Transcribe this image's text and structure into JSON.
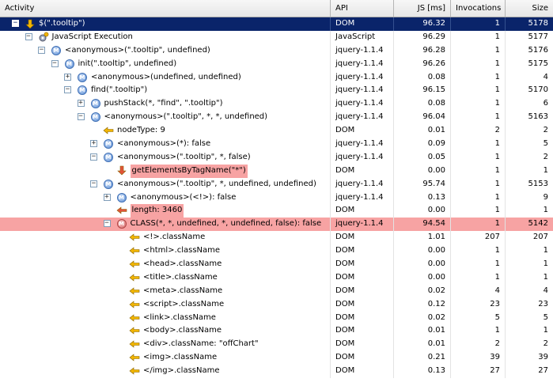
{
  "columns": {
    "activity": "Activity",
    "api": "API",
    "js": "JS [ms]",
    "invocations": "Invocations",
    "size": "Size"
  },
  "rows": [
    {
      "name": "$(\".tooltip\")",
      "api": "DOM",
      "js": "96.32",
      "inv": "1",
      "size": "5178",
      "level": 0,
      "toggle": "−",
      "icon": "arrow-down-icon",
      "selected": true
    },
    {
      "name": "JavaScript Execution",
      "api": "JavaScript",
      "js": "96.29",
      "inv": "1",
      "size": "5177",
      "level": 1,
      "toggle": "−",
      "icon": "gear-icon"
    },
    {
      "name": "<anonymous>(\".tooltip\", undefined)",
      "api": "jquery-1.1.4",
      "js": "96.28",
      "inv": "1",
      "size": "5176",
      "level": 2,
      "toggle": "−",
      "icon": "method-icon"
    },
    {
      "name": "init(\".tooltip\", undefined)",
      "api": "jquery-1.1.4",
      "js": "96.26",
      "inv": "1",
      "size": "5175",
      "level": 3,
      "toggle": "−",
      "icon": "method-icon"
    },
    {
      "name": "<anonymous>(undefined, undefined)",
      "api": "jquery-1.1.4",
      "js": "0.08",
      "inv": "1",
      "size": "4",
      "level": 4,
      "toggle": "+",
      "icon": "method-icon"
    },
    {
      "name": "find(\".tooltip\")",
      "api": "jquery-1.1.4",
      "js": "96.15",
      "inv": "1",
      "size": "5170",
      "level": 4,
      "toggle": "−",
      "icon": "method-icon"
    },
    {
      "name": "pushStack(*, \"find\", \".tooltip\")",
      "api": "jquery-1.1.4",
      "js": "0.08",
      "inv": "1",
      "size": "6",
      "level": 5,
      "toggle": "+",
      "icon": "method-icon"
    },
    {
      "name": "<anonymous>(\".tooltip\", *, *, undefined)",
      "api": "jquery-1.1.4",
      "js": "96.04",
      "inv": "1",
      "size": "5163",
      "level": 5,
      "toggle": "−",
      "icon": "method-icon"
    },
    {
      "name": "nodeType: 9",
      "api": "DOM",
      "js": "0.01",
      "inv": "2",
      "size": "2",
      "level": 6,
      "toggle": "",
      "icon": "arrow-left-icon"
    },
    {
      "name": "<anonymous>(*): false",
      "api": "jquery-1.1.4",
      "js": "0.09",
      "inv": "1",
      "size": "5",
      "level": 6,
      "toggle": "+",
      "icon": "method-icon"
    },
    {
      "name": "<anonymous>(\".tooltip\", *, false)",
      "api": "jquery-1.1.4",
      "js": "0.05",
      "inv": "1",
      "size": "2",
      "level": 6,
      "toggle": "−",
      "icon": "method-icon"
    },
    {
      "name": "getElementsByTagName(\"*\")",
      "api": "DOM",
      "js": "0.00",
      "inv": "1",
      "size": "1",
      "level": 7,
      "toggle": "",
      "icon": "arrow-down-red-icon",
      "hl": "label"
    },
    {
      "name": "<anonymous>(\".tooltip\", *, undefined, undefined)",
      "api": "jquery-1.1.4",
      "js": "95.74",
      "inv": "1",
      "size": "5153",
      "level": 6,
      "toggle": "−",
      "icon": "method-icon"
    },
    {
      "name": "<anonymous>(<!>): false",
      "api": "jquery-1.1.4",
      "js": "0.13",
      "inv": "1",
      "size": "9",
      "level": 7,
      "toggle": "+",
      "icon": "method-icon"
    },
    {
      "name": "length: 3460",
      "api": "DOM",
      "js": "0.00",
      "inv": "1",
      "size": "1",
      "level": 7,
      "toggle": "",
      "icon": "arrow-left-red-icon",
      "hl": "label"
    },
    {
      "name": "CLASS(*, *, undefined, *, undefined, false): false",
      "api": "jquery-1.1.4",
      "js": "94.54",
      "inv": "1",
      "size": "5142",
      "level": 7,
      "toggle": "−",
      "icon": "method-red-icon",
      "hl": "full"
    },
    {
      "name": "<!>.className",
      "api": "DOM",
      "js": "1.01",
      "inv": "207",
      "size": "207",
      "level": 8,
      "toggle": "",
      "icon": "arrow-left-icon"
    },
    {
      "name": "<html>.className",
      "api": "DOM",
      "js": "0.00",
      "inv": "1",
      "size": "1",
      "level": 8,
      "toggle": "",
      "icon": "arrow-left-icon"
    },
    {
      "name": "<head>.className",
      "api": "DOM",
      "js": "0.00",
      "inv": "1",
      "size": "1",
      "level": 8,
      "toggle": "",
      "icon": "arrow-left-icon"
    },
    {
      "name": "<title>.className",
      "api": "DOM",
      "js": "0.00",
      "inv": "1",
      "size": "1",
      "level": 8,
      "toggle": "",
      "icon": "arrow-left-icon"
    },
    {
      "name": "<meta>.className",
      "api": "DOM",
      "js": "0.02",
      "inv": "4",
      "size": "4",
      "level": 8,
      "toggle": "",
      "icon": "arrow-left-icon"
    },
    {
      "name": "<script>.className",
      "api": "DOM",
      "js": "0.12",
      "inv": "23",
      "size": "23",
      "level": 8,
      "toggle": "",
      "icon": "arrow-left-icon"
    },
    {
      "name": "<link>.className",
      "api": "DOM",
      "js": "0.02",
      "inv": "5",
      "size": "5",
      "level": 8,
      "toggle": "",
      "icon": "arrow-left-icon"
    },
    {
      "name": "<body>.className",
      "api": "DOM",
      "js": "0.01",
      "inv": "1",
      "size": "1",
      "level": 8,
      "toggle": "",
      "icon": "arrow-left-icon"
    },
    {
      "name": "<div>.className: \"offChart\"",
      "api": "DOM",
      "js": "0.01",
      "inv": "2",
      "size": "2",
      "level": 8,
      "toggle": "",
      "icon": "arrow-left-icon"
    },
    {
      "name": "<img>.className",
      "api": "DOM",
      "js": "0.21",
      "inv": "39",
      "size": "39",
      "level": 8,
      "toggle": "",
      "icon": "arrow-left-icon"
    },
    {
      "name": "</img>.className",
      "api": "DOM",
      "js": "0.13",
      "inv": "27",
      "size": "27",
      "level": 8,
      "toggle": "",
      "icon": "arrow-left-icon"
    }
  ],
  "colors": {
    "selection": "#0a246a",
    "highlight": "#f7a3a3",
    "arrow": "#f2b600",
    "arrow_red": "#e2533a"
  }
}
